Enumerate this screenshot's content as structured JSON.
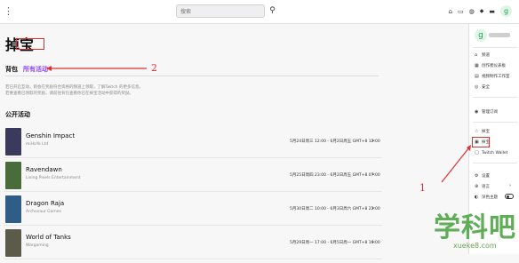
{
  "topbar": {
    "menu": "⋮",
    "search_placeholder": "搜索",
    "search_icon": "search-icon",
    "avatar": "g"
  },
  "page": {
    "title": "掉宝",
    "tabs": [
      "背包",
      "所有活动"
    ],
    "description_line1": "若已开启互动，则会在奖励符合资格的频道上领取，了解Twitch 的更多信息。",
    "description_line2": "若要查看已领取的奖励，请前往背包查看你已在掉宝活动中获得的奖励。",
    "section_title": "公开活动"
  },
  "campaigns": [
    {
      "name": "Genshin Impact",
      "developer": "miHoYo Ltd",
      "dates": "5月24日周三 12:00 - 6月2日周五 GMT+8 12:00",
      "color": "#3b3a5c"
    },
    {
      "name": "Ravendawn",
      "developer": "Living Pixels Entertainment",
      "dates": "5月25日周四 23:00 - 6月2日周五 GMT+8 07:00",
      "color": "#4a6b3a"
    },
    {
      "name": "Dragon Raja",
      "developer": "Archosaur Games",
      "dates": "5月30日周二 10:00 - 6月3日周六 GMT+8 22:00",
      "color": "#2f5d86"
    },
    {
      "name": "World of Tanks",
      "developer": "Wargaming",
      "dates": "5月29日周一 17:00 - 6月5日周一 GMT+8 16:00",
      "color": "#5b5b4a"
    }
  ],
  "panel": {
    "items": [
      {
        "icon": "user-icon",
        "glyph": "⌂",
        "label": "频道"
      },
      {
        "icon": "creator-dashboard-icon",
        "glyph": "▦",
        "label": "创作者仪表板"
      },
      {
        "icon": "video-producer-icon",
        "glyph": "▤",
        "label": "视频制作工作室"
      },
      {
        "icon": "safety-icon",
        "glyph": "◎",
        "label": "安全"
      },
      {
        "icon": "subscription-icon",
        "glyph": "◉",
        "label": "管理订阅"
      },
      {
        "icon": "drops-icon",
        "glyph": "☆",
        "label": "掉宝"
      },
      {
        "icon": "inventory-icon",
        "glyph": "▣",
        "label": "掉宝"
      },
      {
        "icon": "wallet-icon",
        "glyph": "▢",
        "label": "Twitch Wallet"
      },
      {
        "icon": "settings-icon",
        "glyph": "⚙",
        "label": "设置"
      },
      {
        "icon": "language-icon",
        "glyph": "⊕",
        "label": "语言"
      },
      {
        "icon": "dark-theme-icon",
        "glyph": "◐",
        "label": "深色主题"
      }
    ],
    "arrow": "›"
  },
  "annotations": {
    "one": "1",
    "two": "2"
  },
  "watermark": {
    "cn": "学科吧",
    "en": "xueke8.com"
  }
}
